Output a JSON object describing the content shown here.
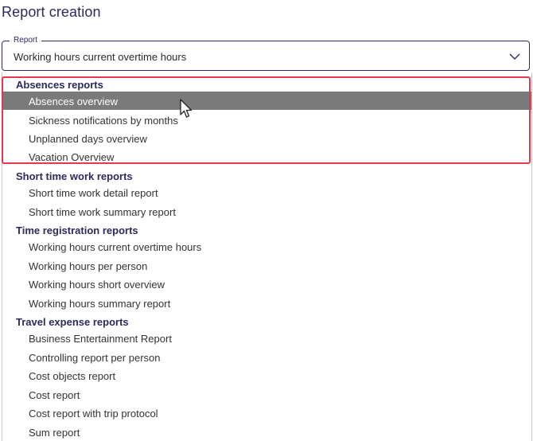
{
  "page": {
    "title": "Report creation"
  },
  "report_select": {
    "label": "Report",
    "value": "Working hours current overtime hours"
  },
  "groups": [
    {
      "header": "Absences reports",
      "items": [
        "Absences overview",
        "Sickness notifications by months",
        "Unplanned days overview",
        "Vacation Overview"
      ]
    },
    {
      "header": "Short time work reports",
      "items": [
        "Short time work detail report",
        "Short time work summary report"
      ]
    },
    {
      "header": "Time registration reports",
      "items": [
        "Working hours current overtime hours",
        "Working hours per person",
        "Working hours short overview",
        "Working hours summary report"
      ]
    },
    {
      "header": "Travel expense reports",
      "items": [
        "Business Entertainment Report",
        "Controlling report per person",
        "Cost objects report",
        "Cost report",
        "Cost report with trip protocol",
        "Sum report"
      ]
    }
  ],
  "colors": {
    "accent": "#2c2a5c",
    "selected_bg": "#7a7a7a",
    "highlight_border": "#e8384f"
  },
  "icons": {
    "dropdown": "chevron-down-icon",
    "cursor": "mouse-pointer-icon"
  }
}
